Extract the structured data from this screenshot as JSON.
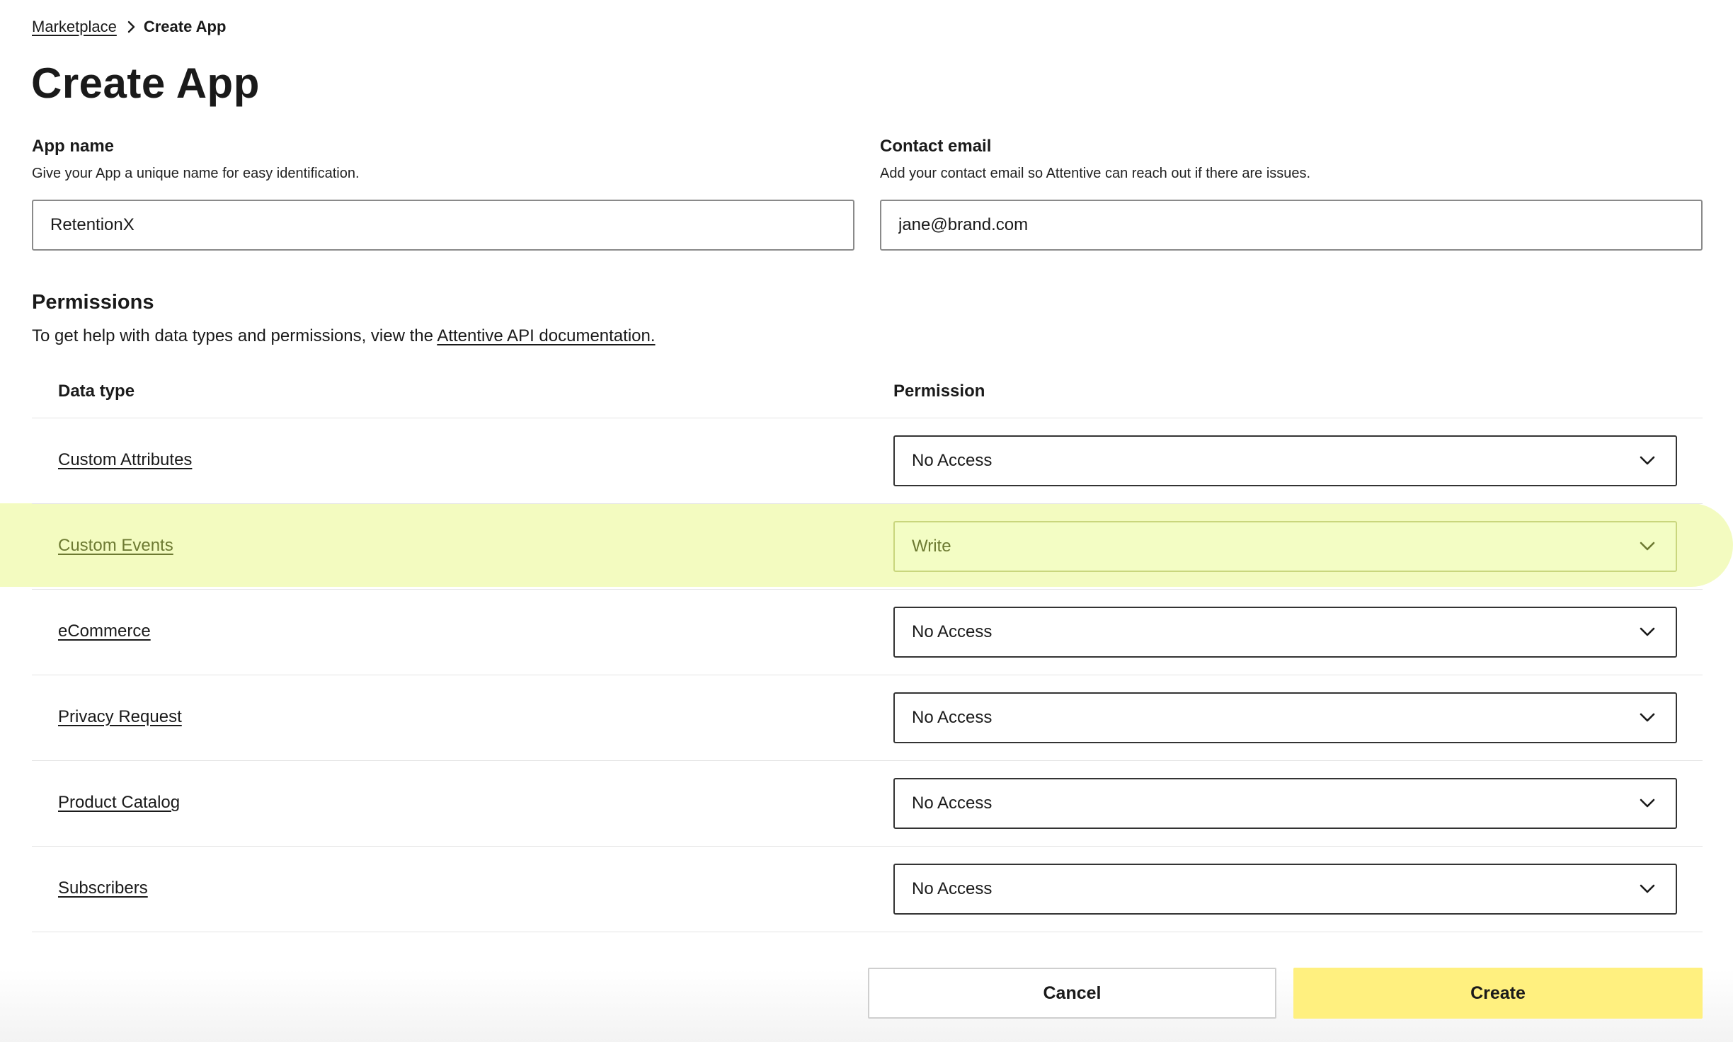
{
  "breadcrumb": {
    "parent": "Marketplace",
    "current": "Create App"
  },
  "page": {
    "title": "Create App"
  },
  "app_name": {
    "label": "App name",
    "help": "Give your App a unique name for easy identification.",
    "value": "RetentionX"
  },
  "contact_email": {
    "label": "Contact email",
    "help": "Add your contact email so Attentive can reach out if there are issues.",
    "value": "jane@brand.com"
  },
  "permissions": {
    "title": "Permissions",
    "help_prefix": "To get help with data types and permissions, view the ",
    "help_link": "Attentive API documentation.",
    "columns": {
      "data_type": "Data type",
      "permission": "Permission"
    },
    "rows": [
      {
        "data_type": "Custom Attributes",
        "permission": "No Access"
      },
      {
        "data_type": "Custom Events",
        "permission": "Write"
      },
      {
        "data_type": "eCommerce",
        "permission": "No Access"
      },
      {
        "data_type": "Privacy Request",
        "permission": "No Access"
      },
      {
        "data_type": "Product Catalog",
        "permission": "No Access"
      },
      {
        "data_type": "Subscribers",
        "permission": "No Access"
      }
    ]
  },
  "actions": {
    "cancel": "Cancel",
    "create": "Create"
  },
  "colors": {
    "highlight": "#f3fbc0",
    "create_button": "#fff07f"
  }
}
